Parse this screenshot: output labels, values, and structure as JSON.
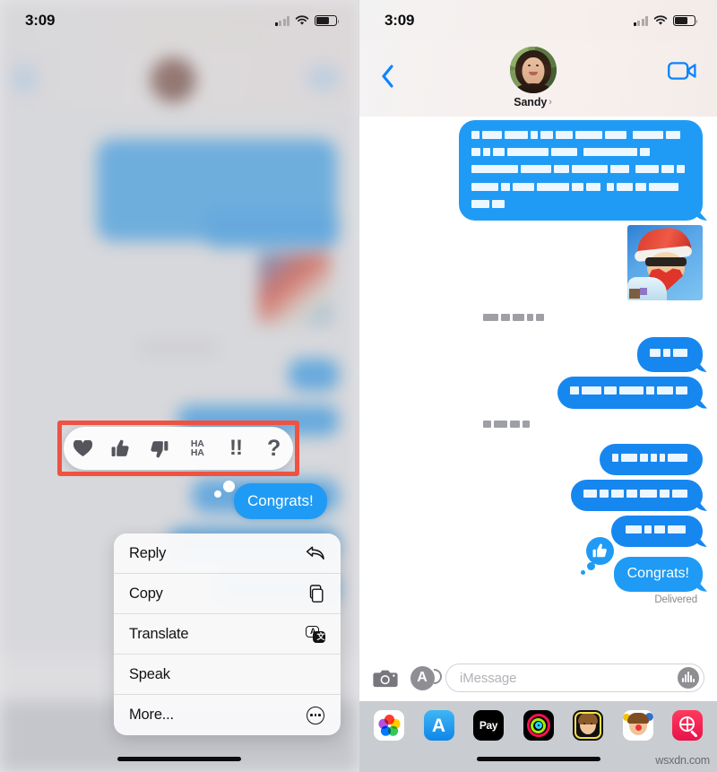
{
  "meta": {
    "watermark": "wsxdn.com"
  },
  "status_bar": {
    "time": "3:09",
    "icons": [
      "cellular-signal-icon",
      "wifi-icon",
      "battery-icon"
    ],
    "battery_level_pct": 68
  },
  "left_panel": {
    "description": "iMessage conversation with context menu and tapback reaction picker open over a blurred thread",
    "focused_bubble": {
      "text": "Congrats!",
      "sender": "outgoing"
    },
    "reaction_picker": {
      "name": "tapback-picker",
      "highlighted": true,
      "highlight_color": "#ef5240",
      "options": [
        {
          "id": "heart",
          "label": "♥",
          "icon": "heart-icon"
        },
        {
          "id": "thumbs-up",
          "label": "",
          "icon": "thumbs-up-icon"
        },
        {
          "id": "thumbs-down",
          "label": "",
          "icon": "thumbs-down-icon"
        },
        {
          "id": "haha",
          "label": "HA HA",
          "icon": "haha-icon"
        },
        {
          "id": "exclamation",
          "label": "!!",
          "icon": "double-exclamation-icon"
        },
        {
          "id": "question",
          "label": "?",
          "icon": "question-mark-icon"
        }
      ]
    },
    "context_menu": {
      "items": [
        {
          "label": "Reply",
          "icon": "reply-arrow-icon"
        },
        {
          "label": "Copy",
          "icon": "copy-pages-icon"
        },
        {
          "label": "Translate",
          "icon": "translate-icon"
        },
        {
          "label": "Speak",
          "icon": ""
        },
        {
          "label": "More...",
          "icon": "ellipsis-circle-icon"
        }
      ]
    }
  },
  "right_panel": {
    "header": {
      "back_icon": "back-chevron-icon",
      "contact_name": "Sandy",
      "contact_chevron": "›",
      "facetime_icon": "facetime-video-icon"
    },
    "thread": {
      "messages": [
        {
          "id": "m1",
          "sender": "outgoing",
          "type": "text",
          "redacted": true,
          "lines": [
            5
          ]
        },
        {
          "id": "m2",
          "sender": "outgoing",
          "type": "image",
          "redacted": true,
          "alt": "santa-sticker-image"
        },
        {
          "id": "m3",
          "sender": "incoming",
          "type": "label",
          "redacted": true
        },
        {
          "id": "m4",
          "sender": "outgoing",
          "type": "text",
          "redacted": true
        },
        {
          "id": "m5",
          "sender": "outgoing",
          "type": "text",
          "redacted": true
        },
        {
          "id": "m6",
          "sender": "incoming",
          "type": "label",
          "redacted": true
        },
        {
          "id": "m7",
          "sender": "outgoing",
          "type": "text",
          "redacted": true
        },
        {
          "id": "m8",
          "sender": "outgoing",
          "type": "text",
          "redacted": true
        },
        {
          "id": "m9",
          "sender": "outgoing",
          "type": "text",
          "redacted": true
        },
        {
          "id": "m10",
          "sender": "outgoing",
          "type": "text",
          "text": "Congrats!",
          "reaction": {
            "type": "thumbs-up",
            "icon": "thumbs-up-icon"
          },
          "status": "Delivered"
        }
      ],
      "delivered_label": "Delivered"
    },
    "input_bar": {
      "camera_icon": "camera-icon",
      "apps_icon": "app-store-icon",
      "placeholder": "iMessage",
      "value": "",
      "audio_icon": "audio-waveform-icon"
    },
    "app_drawer": {
      "apps": [
        {
          "id": "photos",
          "label": "Photos",
          "icon": "photos-icon"
        },
        {
          "id": "appstore",
          "label": "App Store",
          "icon": "app-store-icon"
        },
        {
          "id": "applepay",
          "label": "Pay",
          "icon": "apple-pay-icon"
        },
        {
          "id": "fitness",
          "label": "Fitness",
          "icon": "activity-rings-icon"
        },
        {
          "id": "memoji",
          "label": "Memoji",
          "icon": "memoji-icon"
        },
        {
          "id": "memoji2",
          "label": "Memoji Stickers",
          "icon": "memoji-stickers-icon"
        },
        {
          "id": "images",
          "label": "#images",
          "icon": "images-search-icon"
        }
      ]
    }
  },
  "annotation": {
    "arrow_color": "#ef5240",
    "points_at": "thumbs-up-tapback-on-congrats"
  },
  "colors": {
    "imessage_blue": "#1f9bf5",
    "annotation_red": "#ef5240",
    "drawer_gray": "#c9ccd1",
    "accent_blue": "#007aff"
  }
}
